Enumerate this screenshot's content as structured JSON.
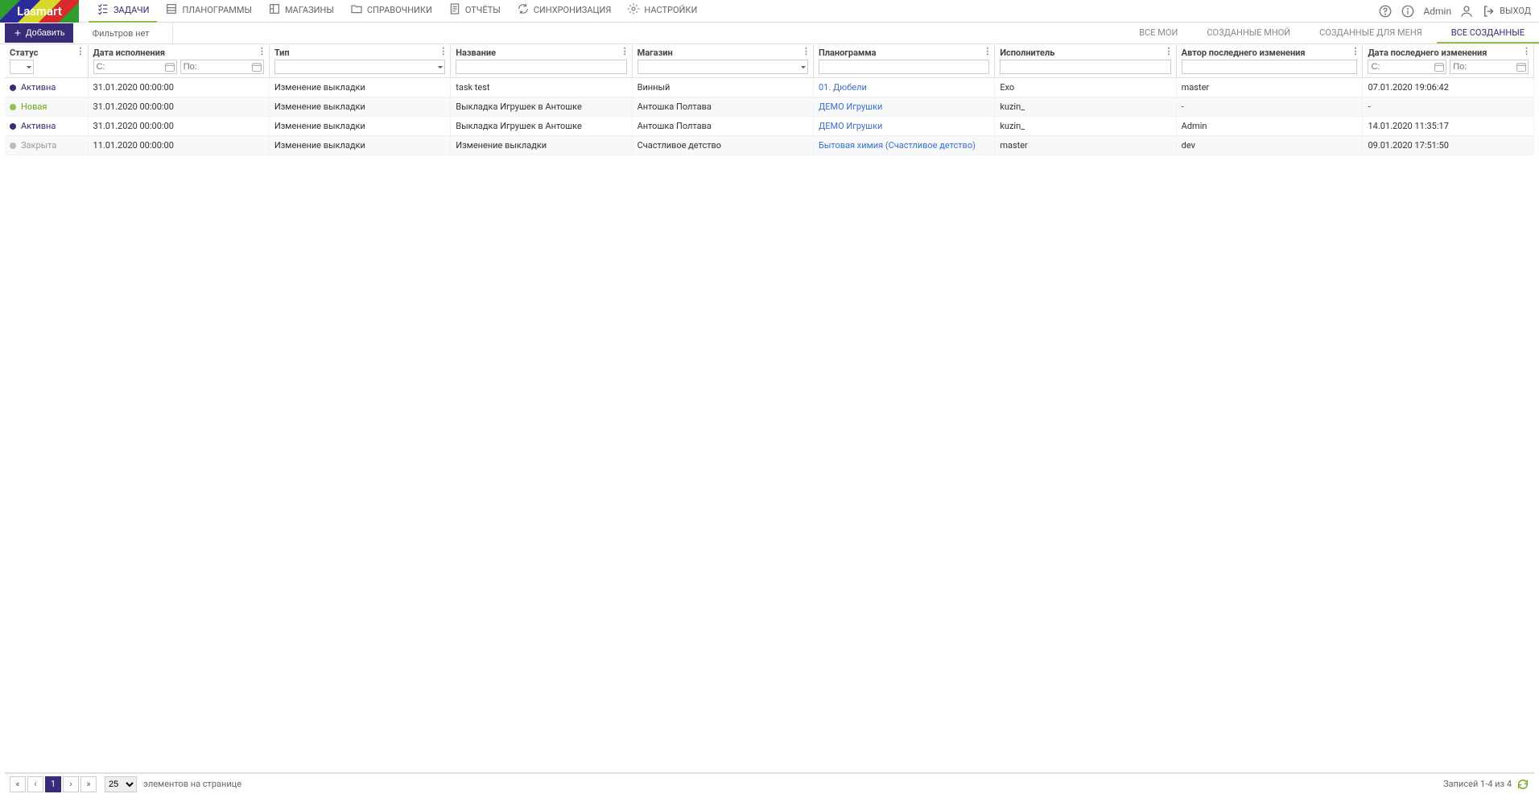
{
  "brand": "Lasmart",
  "nav": [
    {
      "label": "ЗАДАЧИ",
      "active": true,
      "icon": "tasks"
    },
    {
      "label": "ПЛАНОГРАММЫ",
      "active": false,
      "icon": "planogram"
    },
    {
      "label": "МАГАЗИНЫ",
      "active": false,
      "icon": "store"
    },
    {
      "label": "СПРАВОЧНИКИ",
      "active": false,
      "icon": "folder"
    },
    {
      "label": "ОТЧЁТЫ",
      "active": false,
      "icon": "report"
    },
    {
      "label": "СИНХРОНИЗАЦИЯ",
      "active": false,
      "icon": "sync"
    },
    {
      "label": "НАСТРОЙКИ",
      "active": false,
      "icon": "settings"
    }
  ],
  "topRight": {
    "admin": "Admin",
    "exit": "ВЫХОД"
  },
  "toolbar": {
    "add": "Добавить",
    "filtersNone": "Фильтров нет",
    "scopes": [
      {
        "label": "ВСЕ МОИ",
        "active": false
      },
      {
        "label": "СОЗДАННЫЕ МНОЙ",
        "active": false
      },
      {
        "label": "СОЗДАННЫЕ ДЛЯ МЕНЯ",
        "active": false
      },
      {
        "label": "ВСЕ СОЗДАННЫЕ",
        "active": true
      }
    ]
  },
  "columns": {
    "status": "Статус",
    "execDate": "Дата исполнения",
    "type": "Тип",
    "name": "Название",
    "store": "Магазин",
    "planogram": "Планограмма",
    "executor": "Исполнитель",
    "author": "Автор последнего изменения",
    "lastDate": "Дата последнего изменения"
  },
  "filters": {
    "dateFromPh": "С:",
    "dateToPh": "По:"
  },
  "rows": [
    {
      "status": "Активна",
      "statusKind": "active",
      "date": "31.01.2020 00:00:00",
      "type": "Изменение выкладки",
      "name": "task test",
      "store": "Винный",
      "planogram": "01. Дюбели",
      "executor": "Exo",
      "author": "master",
      "lastDate": "07.01.2020 19:06:42"
    },
    {
      "status": "Новая",
      "statusKind": "new",
      "date": "31.01.2020 00:00:00",
      "type": "Изменение выкладки",
      "name": "Выкладка Игрушек в Антошке",
      "store": "Антошка Полтава",
      "planogram": "ДЕМО Игрушки",
      "executor": "kuzin_",
      "author": "-",
      "lastDate": "-"
    },
    {
      "status": "Активна",
      "statusKind": "active",
      "date": "31.01.2020 00:00:00",
      "type": "Изменение выкладки",
      "name": "Выкладка Игрушек в Антошке",
      "store": "Антошка Полтава",
      "planogram": "ДЕМО Игрушки",
      "executor": "kuzin_",
      "author": "Admin",
      "lastDate": "14.01.2020 11:35:17"
    },
    {
      "status": "Закрыта",
      "statusKind": "closed",
      "date": "11.01.2020 00:00:00",
      "type": "Изменение выкладки",
      "name": "Изменение выкладки",
      "store": "Счастливое детство",
      "planogram": "Бытовая химия (Счастливое детство)",
      "executor": "master",
      "author": "dev",
      "lastDate": "09.01.2020 17:51:50"
    }
  ],
  "footer": {
    "pageCurrent": "1",
    "pageSize": "25",
    "perPage": "элементов на странице",
    "records": "Записей 1-4 из 4"
  }
}
